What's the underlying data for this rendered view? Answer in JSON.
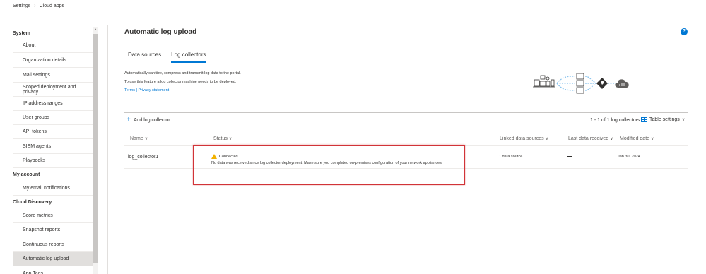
{
  "breadcrumb": {
    "root": "Settings",
    "current": "Cloud apps"
  },
  "sidebar": {
    "sections": [
      {
        "title": "System"
      },
      {
        "title": "My account"
      },
      {
        "title": "Cloud Discovery"
      }
    ],
    "items": [
      {
        "label": "About"
      },
      {
        "label": "Organization details"
      },
      {
        "label": "Mail settings"
      },
      {
        "label": "Scoped deployment and privacy"
      },
      {
        "label": "IP address ranges"
      },
      {
        "label": "User groups"
      },
      {
        "label": "API tokens"
      },
      {
        "label": "SIEM agents"
      },
      {
        "label": "Playbooks"
      },
      {
        "label": "My email notifications"
      },
      {
        "label": "Score metrics"
      },
      {
        "label": "Snapshot reports"
      },
      {
        "label": "Continuous reports"
      },
      {
        "label": "Automatic log upload"
      },
      {
        "label": "App Tags"
      }
    ]
  },
  "page": {
    "title": "Automatic log upload",
    "help": "?"
  },
  "tabs": [
    {
      "label": "Data sources"
    },
    {
      "label": "Log collectors"
    }
  ],
  "description": {
    "line1": "Automatically sanitize, compress and transmit log data to the portal.",
    "line2": "To use this feature a log collector machine needs to be deployed.",
    "links": "Terms | Privacy statement"
  },
  "toolbar": {
    "add_label": "Add log collector...",
    "count": "1 - 1 of 1 log collectors",
    "table_settings": "Table settings"
  },
  "table": {
    "columns": [
      "Name",
      "Status",
      "Linked data sources",
      "Last data received",
      "Modified date"
    ],
    "rows": [
      {
        "name": "log_collector1",
        "status_title": "Connected",
        "status_message": "No data was received since log collector deployment. Make sure you completed on-premises configuration of your network appliances.",
        "linked": "1 data source",
        "last_received": "—",
        "modified": "Jan 30, 2024"
      }
    ]
  },
  "colors": {
    "accent": "#0078d4",
    "highlight_box": "#d13438",
    "warning": "#f2b200",
    "diagram_line": "#8bc4ee"
  }
}
